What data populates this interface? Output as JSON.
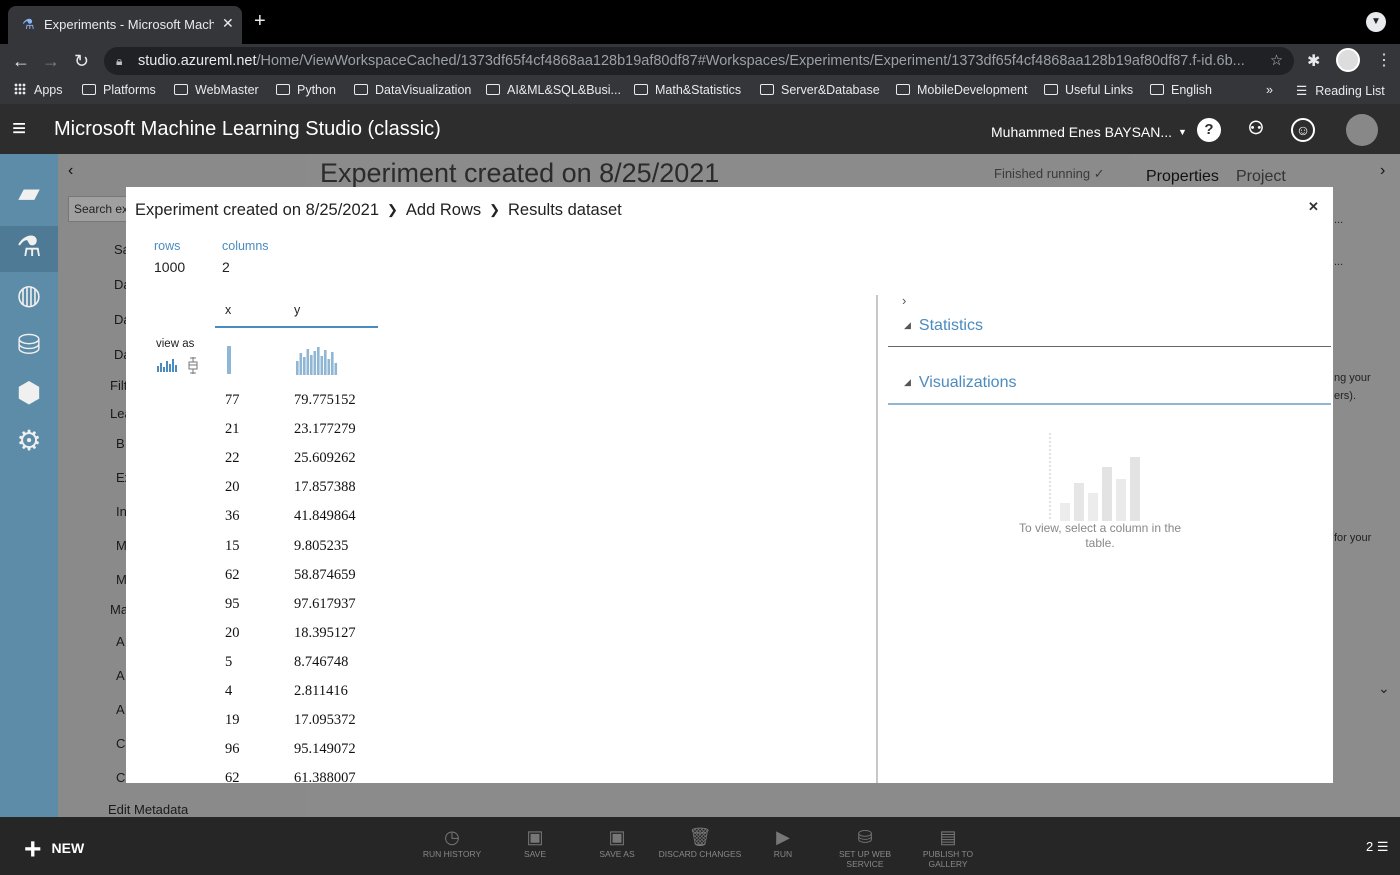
{
  "browser": {
    "tab_title": "Experiments - Microsoft Machi",
    "url_host": "studio.azureml.net",
    "url_path": "/Home/ViewWorkspaceCached/1373df65f4cf4868aa128b19af80df87#Workspaces/Experiments/Experiment/1373df65f4cf4868aa128b19af80df87.f-id.6b...",
    "bookmarks": [
      "Apps",
      "Platforms",
      "WebMaster",
      "Python",
      "DataVisualization",
      "AI&ML&SQL&Busi...",
      "Math&Statistics",
      "Server&Database",
      "MobileDevelopment",
      "Useful Links",
      "English"
    ],
    "bookmarks_overflow": "»",
    "reading_list": "Reading List"
  },
  "app": {
    "title": "Microsoft Machine Learning Studio (classic)",
    "user": "Muhammed Enes BAYSAN...",
    "help": "?"
  },
  "palette": {
    "search_placeholder": "Search ex",
    "items": [
      "Sa",
      "Da",
      "Da",
      "Da",
      "Filt",
      "Lea",
      "B",
      "Ex",
      "In",
      "M",
      "M",
      "Ma",
      "A",
      "A",
      "A",
      "C",
      "C"
    ],
    "edit_metadata": "Edit Metadata"
  },
  "canvas": {
    "title": "Experiment created on 8/25/2021",
    "status": "Finished running ✓"
  },
  "right_panel": {
    "properties": "Properties",
    "project": "Project",
    "dots1": "...",
    "dots2": "...",
    "text1": "ng your",
    "text2": "ers).",
    "text3": "for your"
  },
  "bottom_bar": {
    "new_label": "NEW",
    "buttons": [
      "RUN HISTORY",
      "SAVE",
      "SAVE AS",
      "DISCARD CHANGES",
      "RUN",
      "SET UP WEB SERVICE",
      "PUBLISH TO GALLERY"
    ],
    "count": "2"
  },
  "modal": {
    "breadcrumb": [
      "Experiment created on 8/25/2021",
      "Add Rows",
      "Results dataset"
    ],
    "rows_label": "rows",
    "rows_value": "1000",
    "columns_label": "columns",
    "columns_value": "2",
    "view_as": "view as",
    "column_headers": [
      "x",
      "y"
    ],
    "rows": [
      [
        "77",
        "79.775152"
      ],
      [
        "21",
        "23.177279"
      ],
      [
        "22",
        "25.609262"
      ],
      [
        "20",
        "17.857388"
      ],
      [
        "36",
        "41.849864"
      ],
      [
        "15",
        "9.805235"
      ],
      [
        "62",
        "58.874659"
      ],
      [
        "95",
        "97.617937"
      ],
      [
        "20",
        "18.395127"
      ],
      [
        "5",
        "8.746748"
      ],
      [
        "4",
        "2.811416"
      ],
      [
        "19",
        "17.095372"
      ],
      [
        "96",
        "95.149072"
      ],
      [
        "62",
        "61.388007"
      ]
    ],
    "statistics_label": "Statistics",
    "visualizations_label": "Visualizations",
    "visualizations_hint": "To view, select a column in the table.",
    "colors": {
      "accent": "#4b8bbe",
      "light_accent": "#8fb6d3"
    }
  }
}
